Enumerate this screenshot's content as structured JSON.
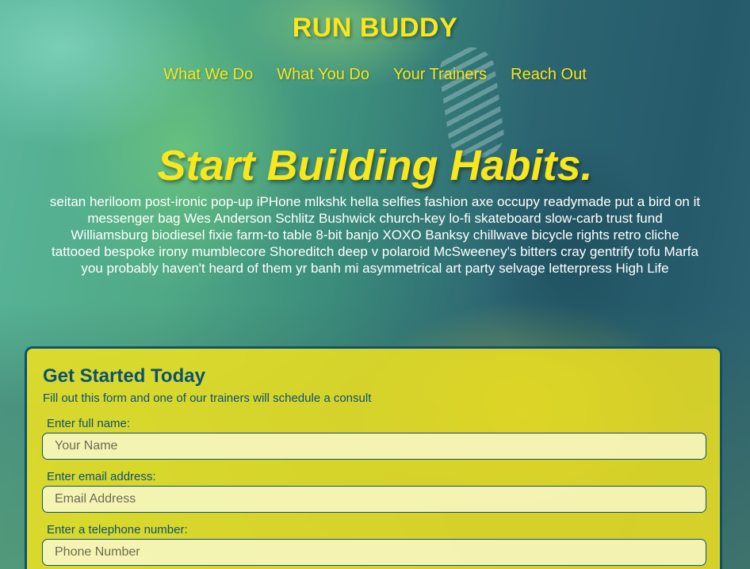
{
  "header": {
    "brand": "RUN BUDDY",
    "nav": [
      {
        "label": "What We Do"
      },
      {
        "label": "What You Do"
      },
      {
        "label": "Your Trainers"
      },
      {
        "label": "Reach Out"
      }
    ]
  },
  "hero": {
    "title": "Start Building Habits.",
    "body": "seitan heriloom post-ironic pop-up iPHone mlkshk hella selfies fashion axe occupy readymade put a bird on it messenger bag Wes Anderson Schlitz Bushwick church-key lo-fi skateboard slow-carb trust fund Williamsburg biodiesel fixie farm-to table 8-bit banjo XOXO Banksy chillwave bicycle rights retro cliche tattooed bespoke irony mumblecore Shoreditch deep v polaroid McSweeney's bitters cray gentrify tofu Marfa you probably haven't heard of them yr banh mi asymmetrical art party selvage letterpress High Life"
  },
  "form": {
    "title": "Get Started Today",
    "subtitle": "Fill out this form and one of our trainers will schedule a consult",
    "fields": [
      {
        "label": "Enter full name:",
        "placeholder": "Your Name",
        "value": ""
      },
      {
        "label": "Enter email address:",
        "placeholder": "Email Address",
        "value": ""
      },
      {
        "label": "Enter a telephone number:",
        "placeholder": "Phone Number",
        "value": ""
      }
    ]
  },
  "colors": {
    "accent": "#f8e71c",
    "primary_dark": "#0c5270",
    "text_light": "#ffffff"
  }
}
